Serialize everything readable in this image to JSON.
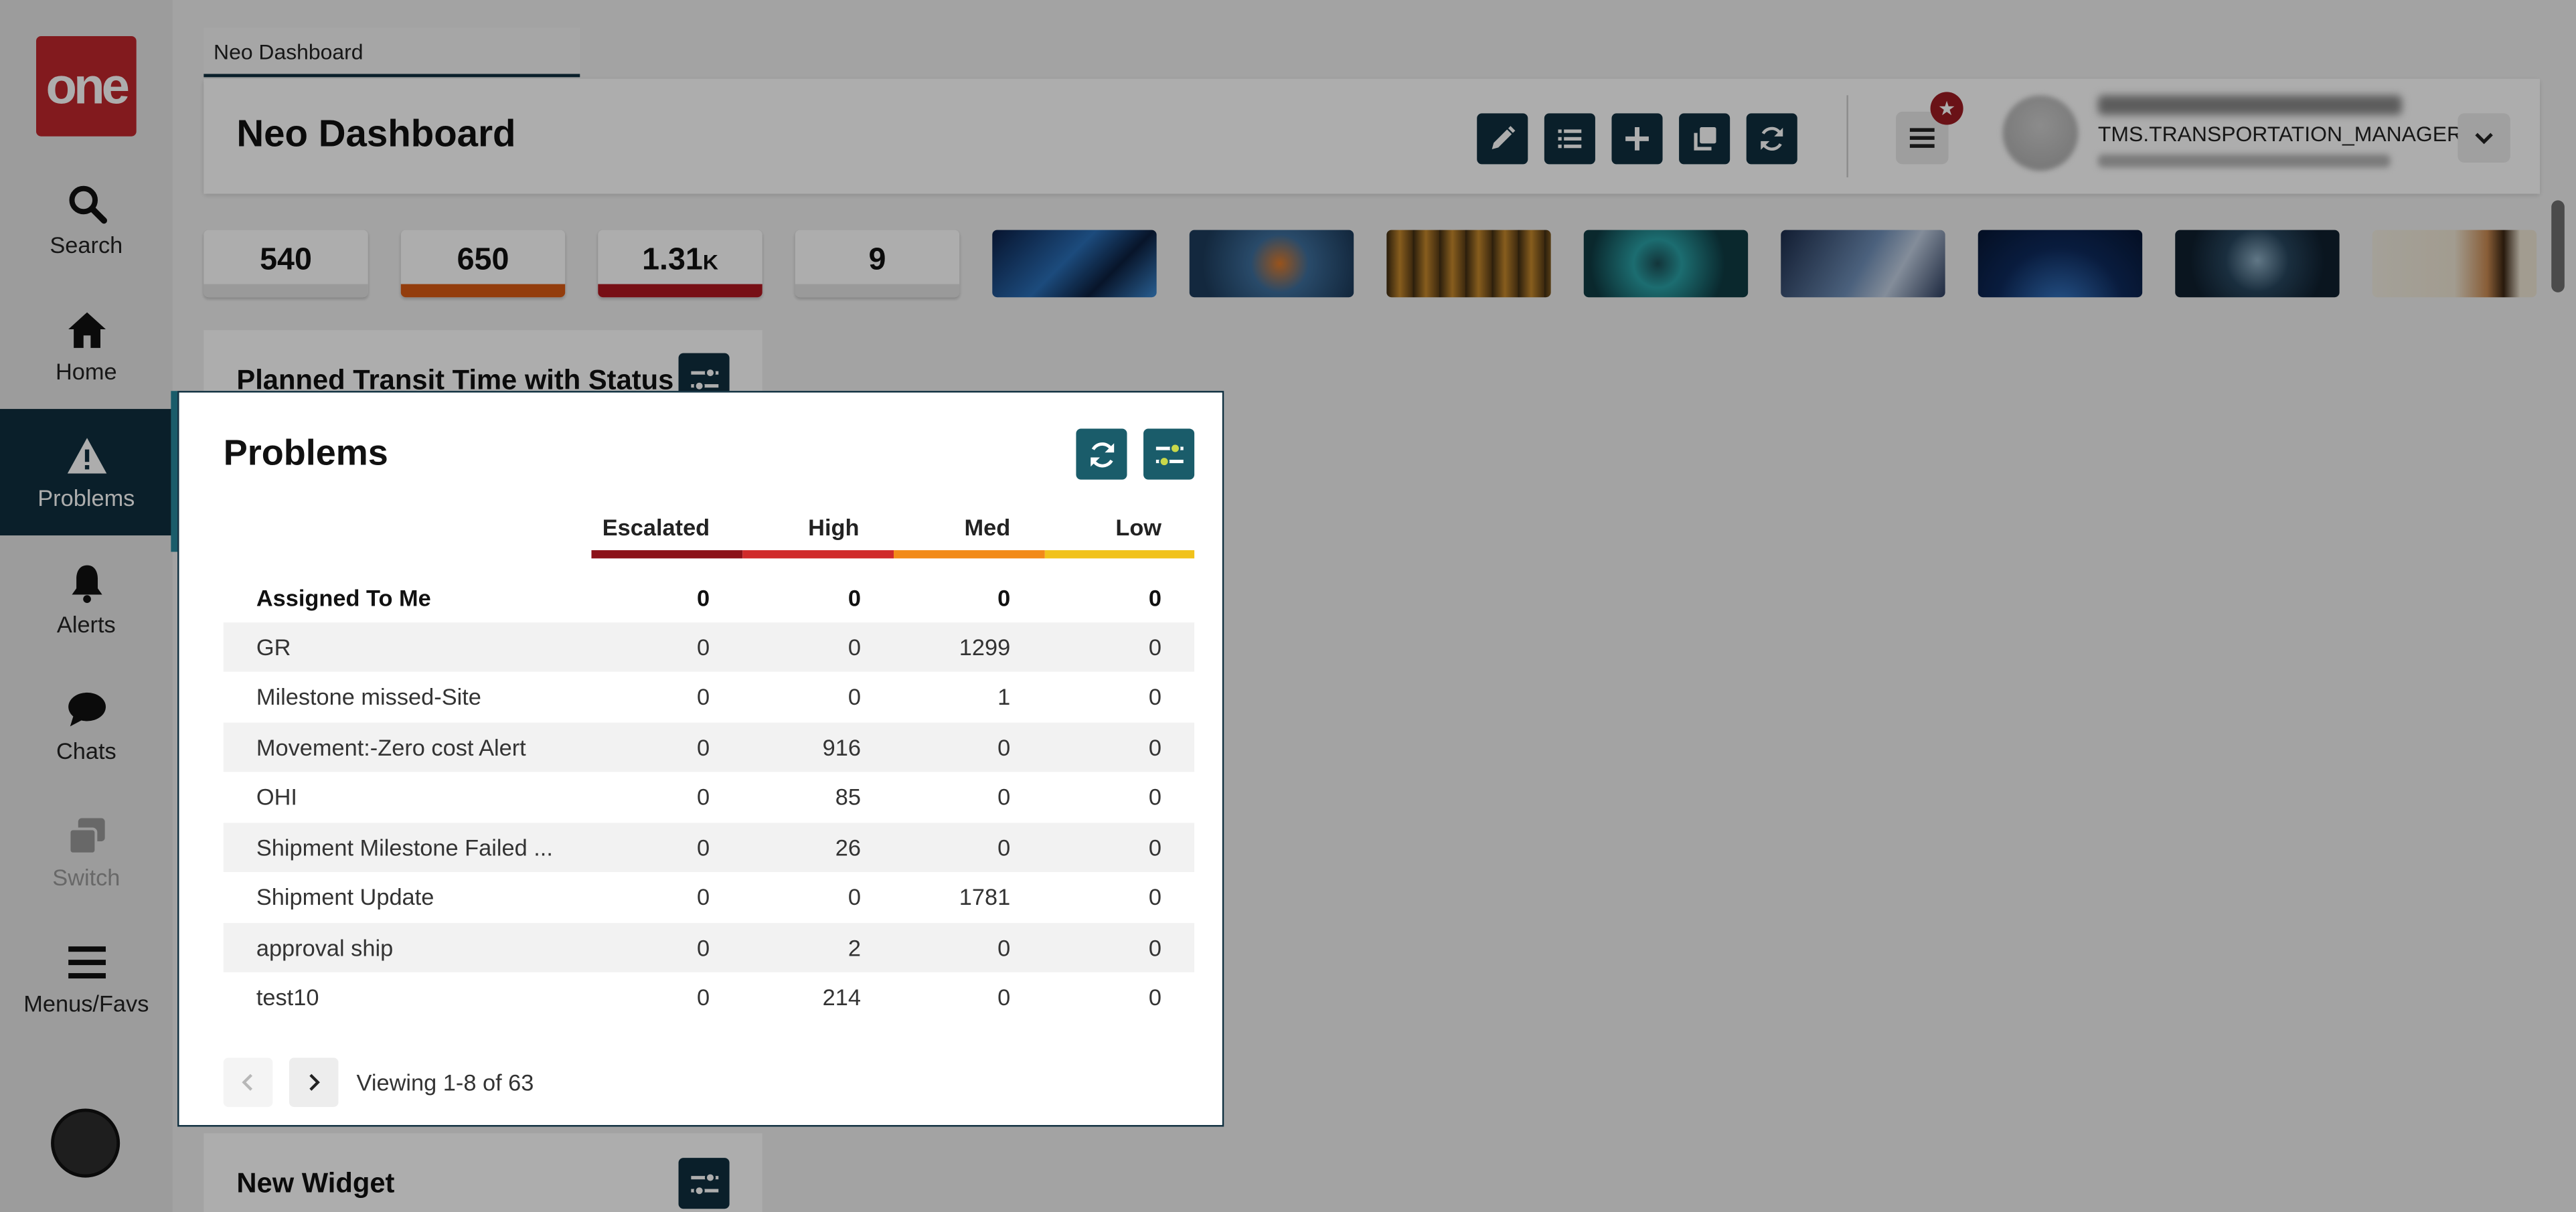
{
  "sidebar": {
    "logo_text": "one",
    "items": [
      {
        "label": "Search",
        "icon": "search-icon"
      },
      {
        "label": "Home",
        "icon": "home-icon"
      },
      {
        "label": "Problems",
        "icon": "warning-icon",
        "active": true
      },
      {
        "label": "Alerts",
        "icon": "bell-icon"
      },
      {
        "label": "Chats",
        "icon": "chat-bubble-icon"
      },
      {
        "label": "Switch",
        "icon": "switch-icon",
        "disabled": true
      },
      {
        "label": "Menus/Favs",
        "icon": "hamburger-menu-icon"
      }
    ]
  },
  "tab": {
    "label": "Neo Dashboard"
  },
  "header": {
    "title": "Neo Dashboard",
    "tools": [
      "edit-icon",
      "list-icon",
      "plus-icon",
      "copy-icon",
      "refresh-icon"
    ],
    "user_role": "TMS.TRANSPORTATION_MANAGER"
  },
  "stat_tiles": [
    {
      "value": "540",
      "color": "#e3e3e3"
    },
    {
      "value": "650",
      "color": "#d95a14"
    },
    {
      "value": "1.31",
      "suffix": "K",
      "color": "#b0171f"
    },
    {
      "value": "9",
      "color": "#e3e3e3"
    }
  ],
  "widgets": {
    "planned_transit": "Planned Transit Time with Status",
    "new_widget": "New Widget"
  },
  "problems": {
    "title": "Problems",
    "columns": [
      "Escalated",
      "High",
      "Med",
      "Low"
    ],
    "column_colors": [
      "#8c1118",
      "#d02a2a",
      "#f28a18",
      "#f1c21b"
    ],
    "rows": [
      {
        "label": "Assigned To Me",
        "values": [
          "0",
          "0",
          "0",
          "0"
        ]
      },
      {
        "label": "GR",
        "values": [
          "0",
          "0",
          "1299",
          "0"
        ]
      },
      {
        "label": "Milestone missed-Site",
        "values": [
          "0",
          "0",
          "1",
          "0"
        ]
      },
      {
        "label": "Movement:-Zero cost Alert",
        "values": [
          "0",
          "916",
          "0",
          "0"
        ]
      },
      {
        "label": "OHI",
        "values": [
          "0",
          "85",
          "0",
          "0"
        ]
      },
      {
        "label": "Shipment Milestone Failed ...",
        "values": [
          "0",
          "26",
          "0",
          "0"
        ]
      },
      {
        "label": "Shipment Update",
        "values": [
          "0",
          "0",
          "1781",
          "0"
        ]
      },
      {
        "label": "approval ship",
        "values": [
          "0",
          "2",
          "0",
          "0"
        ]
      },
      {
        "label": "test10",
        "values": [
          "0",
          "214",
          "0",
          "0"
        ]
      }
    ],
    "pager_text": "Viewing 1-8 of 63"
  }
}
